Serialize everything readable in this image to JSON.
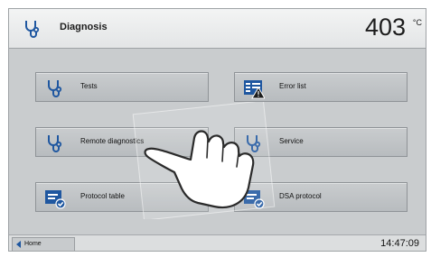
{
  "header": {
    "title": "Diagnosis",
    "temperature": "403",
    "unit": "°C",
    "icon": "stethoscope-icon"
  },
  "tiles": [
    {
      "label": "Tests",
      "icon": "stethoscope-icon"
    },
    {
      "label": "Error list",
      "icon": "error-list-warning-icon"
    },
    {
      "label": "Remote diagnostics",
      "icon": "stethoscope-icon"
    },
    {
      "label": "Service",
      "icon": "stethoscope-icon"
    },
    {
      "label": "Protocol table",
      "icon": "protocol-check-icon"
    },
    {
      "label": "DSA protocol",
      "icon": "protocol-check-icon"
    }
  ],
  "footer": {
    "home_label": "Home",
    "time": "14:47:09"
  },
  "colors": {
    "accent_blue": "#1f57a0",
    "panel_bg": "#c9ccce",
    "header_bg": "#eceeee",
    "warning_dark": "#1c1c1c"
  },
  "overlay": {
    "hand_icon": "pointing-hand-icon"
  }
}
